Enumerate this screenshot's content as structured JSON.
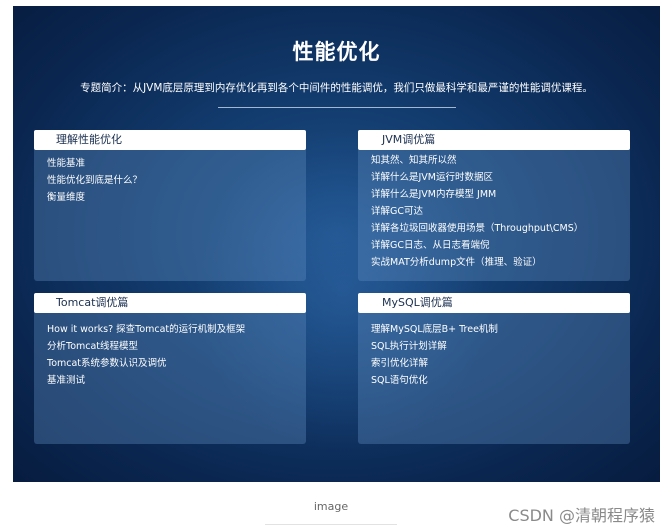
{
  "banner": {
    "title": "性能优化",
    "intro": "专题简介：从JVM底层原理到内存优化再到各个中间件的性能调优，我们只做最科学和最严谨的性能调优课程。"
  },
  "cards": [
    {
      "title": "理解性能优化",
      "items": [
        "性能基准",
        "性能优化到底是什么？",
        "衡量维度"
      ]
    },
    {
      "title": "JVM调优篇",
      "items": [
        "知其然、知其所以然",
        "详解什么是JVM运行时数据区",
        "详解什么是JVM内存模型 JMM",
        "详解GC可达",
        "详解各垃圾回收器使用场景（Throughput\\CMS）",
        "详解GC日志、从日志看端倪",
        "实战MAT分析dump文件（推理、验证）"
      ]
    },
    {
      "title": "Tomcat调优篇",
      "items": [
        "How it works? 探查Tomcat的运行机制及框架",
        "分析Tomcat线程模型",
        "Tomcat系统参数认识及调优",
        "基准测试"
      ]
    },
    {
      "title": "MySQL调优篇",
      "items": [
        "理解MySQL底层B+ Tree机制",
        "SQL执行计划详解",
        "索引优化详解",
        "SQL语句优化"
      ]
    }
  ],
  "caption": "image",
  "watermark": "CSDN @清朝程序猿",
  "colors": {
    "banner_dark": "#071c3f",
    "banner_mid": "#1d5089",
    "card_header_text": "#1a2f4f"
  }
}
